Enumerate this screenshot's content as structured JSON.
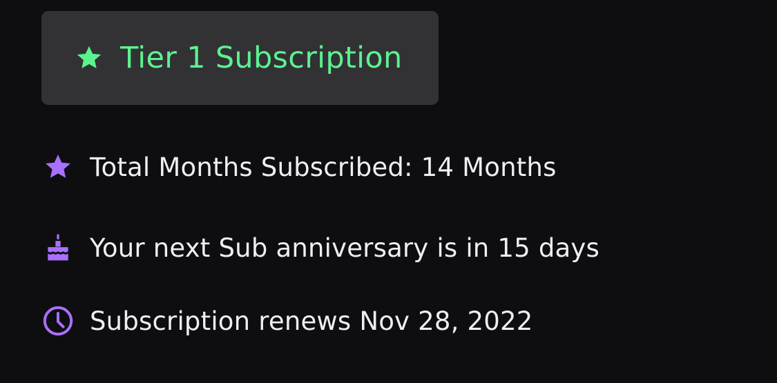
{
  "tier": {
    "label": "Tier 1 Subscription",
    "icon": "star-icon",
    "accent_color": "#5cf290"
  },
  "details": [
    {
      "icon": "star-icon",
      "text": "Total Months Subscribed: 14 Months"
    },
    {
      "icon": "cake-icon",
      "text": "Your next Sub anniversary is in 15 days"
    },
    {
      "icon": "clock-icon",
      "text": "Subscription renews Nov 28, 2022"
    }
  ],
  "colors": {
    "background": "#0e0e10",
    "badge_bg": "#323235",
    "icon_purple": "#a970ff",
    "text": "#efeff1"
  }
}
